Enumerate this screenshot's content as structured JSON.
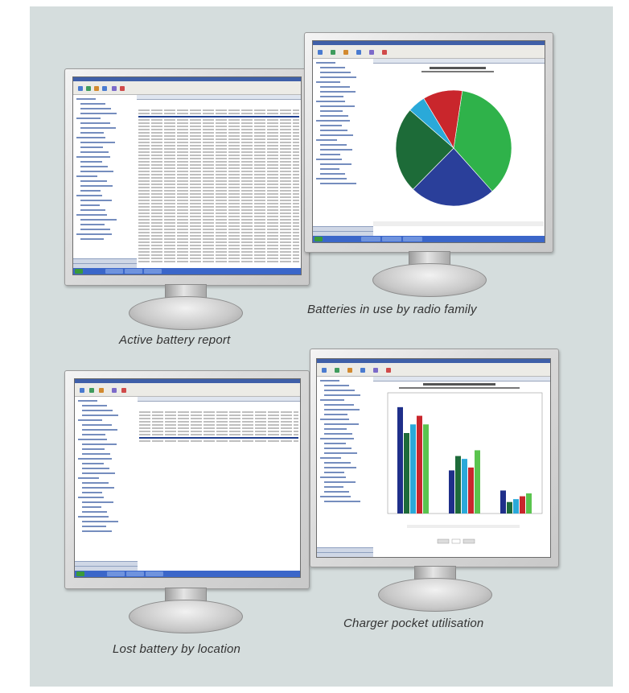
{
  "captions": {
    "active": "Active battery report",
    "radio": "Batteries in use by radio family",
    "lost": "Lost battery by location",
    "charger": "Charger pocket utilisation"
  },
  "colors": {
    "panel": "#d5dddd",
    "bezel": "#dcdcdc",
    "titlebar": "#3f5fa8",
    "taskbar": "#3b66c9"
  },
  "pie_chart": {
    "slices": [
      {
        "label": "green",
        "value": 36,
        "color": "#2fb24a"
      },
      {
        "label": "navy",
        "value": 24,
        "color": "#2a3f9a"
      },
      {
        "label": "dark-green",
        "value": 24,
        "color": "#1d6b38"
      },
      {
        "label": "cyan",
        "value": 5,
        "color": "#2aa9d9"
      },
      {
        "label": "red",
        "value": 11,
        "color": "#c9262c"
      }
    ]
  },
  "bar_chart": {
    "series_colors": [
      "#1f2f8a",
      "#1e6b3a",
      "#2aa9d9",
      "#c9262c",
      "#5ac44e"
    ],
    "groups": [
      [
        37,
        28,
        31,
        34,
        31
      ],
      [
        15,
        20,
        19,
        16,
        22
      ],
      [
        8,
        4,
        5,
        6,
        7
      ]
    ],
    "ymax": 42
  }
}
